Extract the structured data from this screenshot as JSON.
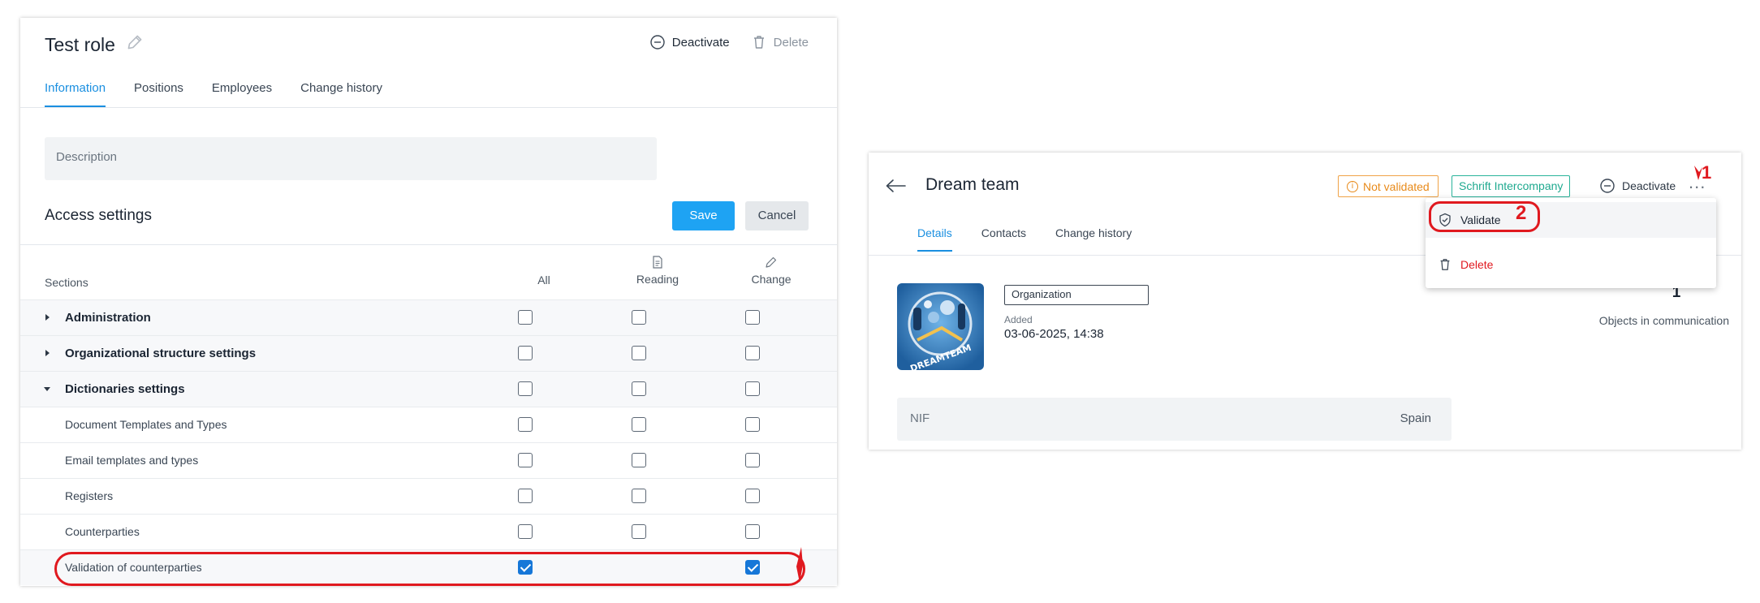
{
  "left": {
    "title": "Test role",
    "actions": {
      "deactivate": "Deactivate",
      "delete": "Delete"
    },
    "tabs": [
      "Information",
      "Positions",
      "Employees",
      "Change history"
    ],
    "description_placeholder": "Description",
    "access_title": "Access settings",
    "save_label": "Save",
    "cancel_label": "Cancel",
    "columns": {
      "sections": "Sections",
      "all": "All",
      "reading": "Reading",
      "change": "Change"
    },
    "rows": [
      {
        "label": "Administration",
        "type": "group",
        "expanded": false,
        "all": false,
        "reading": false,
        "change": false
      },
      {
        "label": "Organizational structure settings",
        "type": "group",
        "expanded": false,
        "all": false,
        "reading": false,
        "change": false
      },
      {
        "label": "Dictionaries settings",
        "type": "group",
        "expanded": true,
        "all": false,
        "reading": false,
        "change": false
      },
      {
        "label": "Document Templates and Types",
        "type": "child",
        "all": false,
        "reading": false,
        "change": false
      },
      {
        "label": "Email templates and types",
        "type": "child",
        "all": false,
        "reading": false,
        "change": false
      },
      {
        "label": "Registers",
        "type": "child",
        "all": false,
        "reading": false,
        "change": false
      },
      {
        "label": "Counterparties",
        "type": "child",
        "all": false,
        "reading": false,
        "change": false
      },
      {
        "label": "Validation of counterparties",
        "type": "child",
        "all": true,
        "change": true
      }
    ]
  },
  "right": {
    "title": "Dream team",
    "status_badge": "Not validated",
    "company_badge": "Schrift Intercompany",
    "deactivate": "Deactivate",
    "more": "...",
    "tabs": [
      "Details",
      "Contacts",
      "Change history"
    ],
    "logo_text": "DREAMTEAM",
    "type_value": "Organization",
    "added_label": "Added",
    "added_value": "03-06-2025, 14:38",
    "count": "1",
    "count_label": "Objects in communication",
    "nif_label": "NIF",
    "nif_value": "Spain",
    "menu": {
      "validate": "Validate",
      "delete": "Delete"
    },
    "annotations": {
      "step1": "1",
      "step2": "2"
    }
  },
  "colors": {
    "accent": "#1a8fe0",
    "save": "#1ea3f3",
    "annotation": "#e0191f",
    "warning": "#e88a1a",
    "company": "#1ea98f"
  }
}
